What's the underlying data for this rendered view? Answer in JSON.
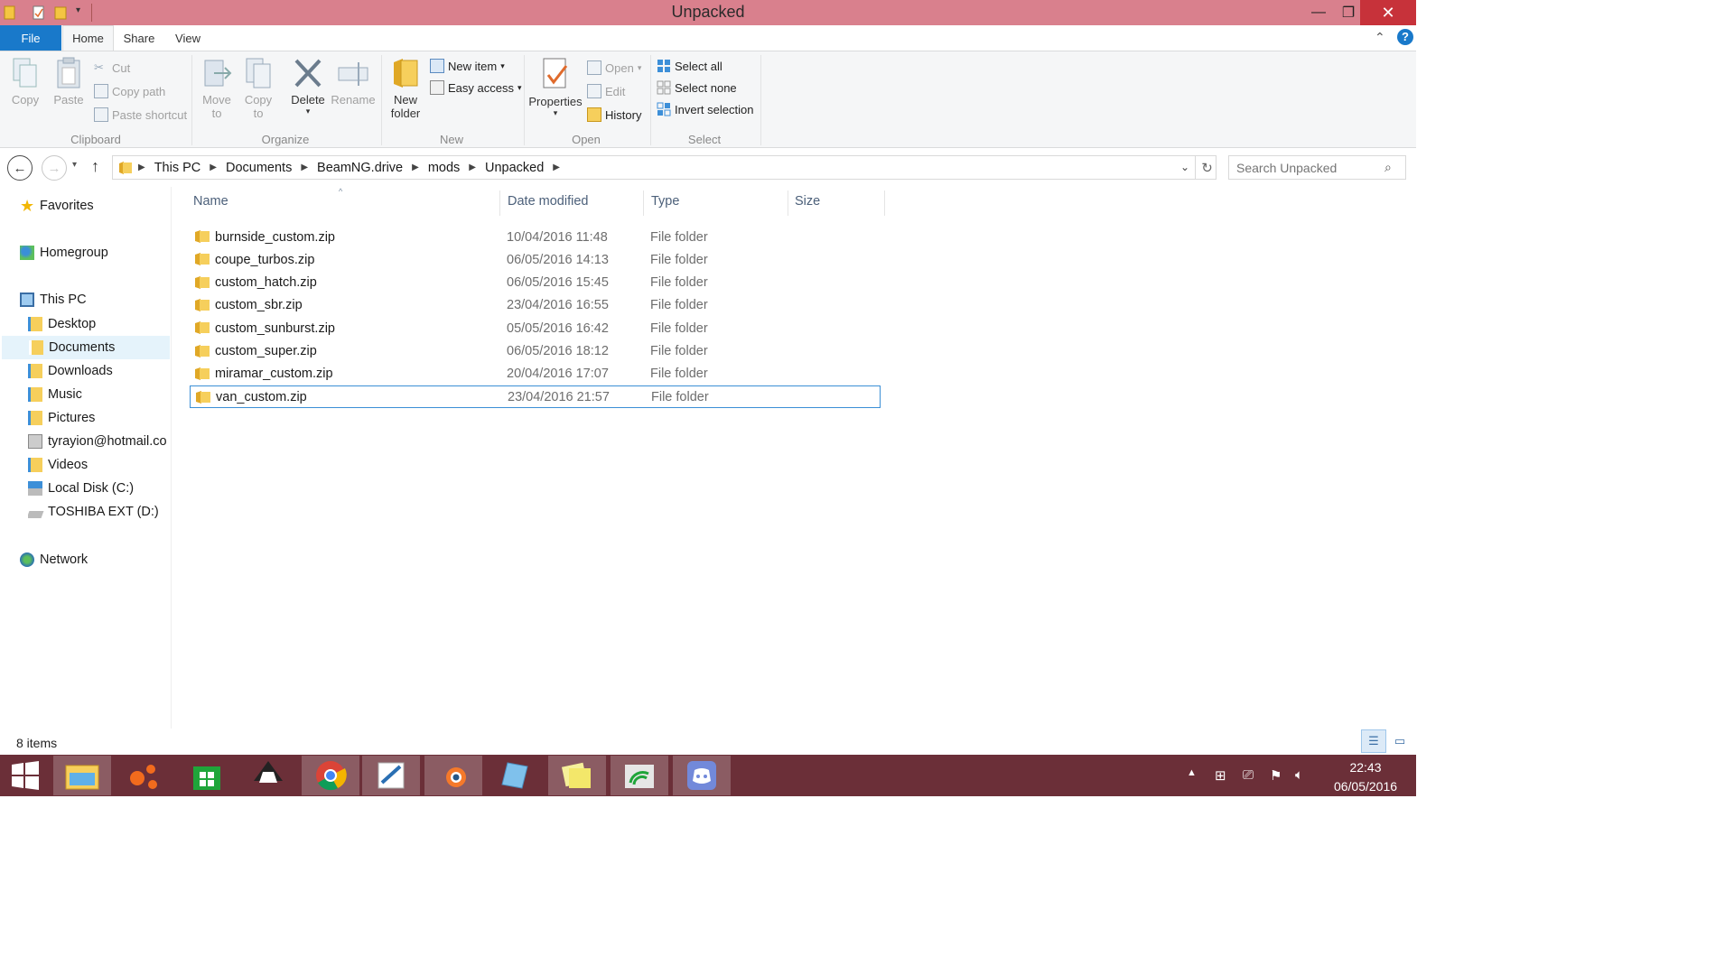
{
  "window": {
    "title": "Unpacked"
  },
  "window_controls": {
    "minimize": "—",
    "maximize": "❐",
    "close": "✕"
  },
  "ribbon": {
    "tabs": {
      "file": "File",
      "home": "Home",
      "share": "Share",
      "view": "View"
    },
    "clipboard": {
      "copy": "Copy",
      "paste": "Paste",
      "cut": "Cut",
      "copy_path": "Copy path",
      "paste_shortcut": "Paste shortcut",
      "label": "Clipboard"
    },
    "organize": {
      "move_to_1": "Move",
      "move_to_2": "to",
      "copy_to_1": "Copy",
      "copy_to_2": "to",
      "delete": "Delete",
      "rename": "Rename",
      "label": "Organize"
    },
    "new": {
      "new_folder_1": "New",
      "new_folder_2": "folder",
      "new_item": "New item",
      "easy_access": "Easy access",
      "label": "New"
    },
    "open": {
      "properties": "Properties",
      "open": "Open",
      "edit": "Edit",
      "history": "History",
      "label": "Open"
    },
    "select": {
      "select_all": "Select all",
      "select_none": "Select none",
      "invert_selection": "Invert selection",
      "label": "Select"
    }
  },
  "address": {
    "crumbs": [
      "This PC",
      "Documents",
      "BeamNG.drive",
      "mods",
      "Unpacked"
    ],
    "search_placeholder": "Search Unpacked"
  },
  "sidebar": {
    "favorites": "Favorites",
    "homegroup": "Homegroup",
    "this_pc": "This PC",
    "items": [
      "Desktop",
      "Documents",
      "Downloads",
      "Music",
      "Pictures",
      "tyrayion@hotmail.co",
      "Videos",
      "Local Disk (C:)",
      "TOSHIBA EXT (D:)"
    ],
    "network": "Network"
  },
  "columns": {
    "name": "Name",
    "date": "Date modified",
    "type": "Type",
    "size": "Size"
  },
  "files": [
    {
      "name": "burnside_custom.zip",
      "date": "10/04/2016 11:48",
      "type": "File folder"
    },
    {
      "name": "coupe_turbos.zip",
      "date": "06/05/2016 14:13",
      "type": "File folder"
    },
    {
      "name": "custom_hatch.zip",
      "date": "06/05/2016 15:45",
      "type": "File folder"
    },
    {
      "name": "custom_sbr.zip",
      "date": "23/04/2016 16:55",
      "type": "File folder"
    },
    {
      "name": "custom_sunburst.zip",
      "date": "05/05/2016 16:42",
      "type": "File folder"
    },
    {
      "name": "custom_super.zip",
      "date": "06/05/2016 18:12",
      "type": "File folder"
    },
    {
      "name": "miramar_custom.zip",
      "date": "20/04/2016 17:07",
      "type": "File folder"
    },
    {
      "name": "van_custom.zip",
      "date": "23/04/2016 21:57",
      "type": "File folder"
    }
  ],
  "status": {
    "items": "8 items"
  },
  "clock": {
    "time": "22:43",
    "date": "06/05/2016"
  },
  "colors": {
    "titlebar": "#d9808d",
    "file_tab": "#1979ca",
    "taskbar": "#6b2f38",
    "close": "#c7323a",
    "selection_border": "#3b8fd6"
  }
}
